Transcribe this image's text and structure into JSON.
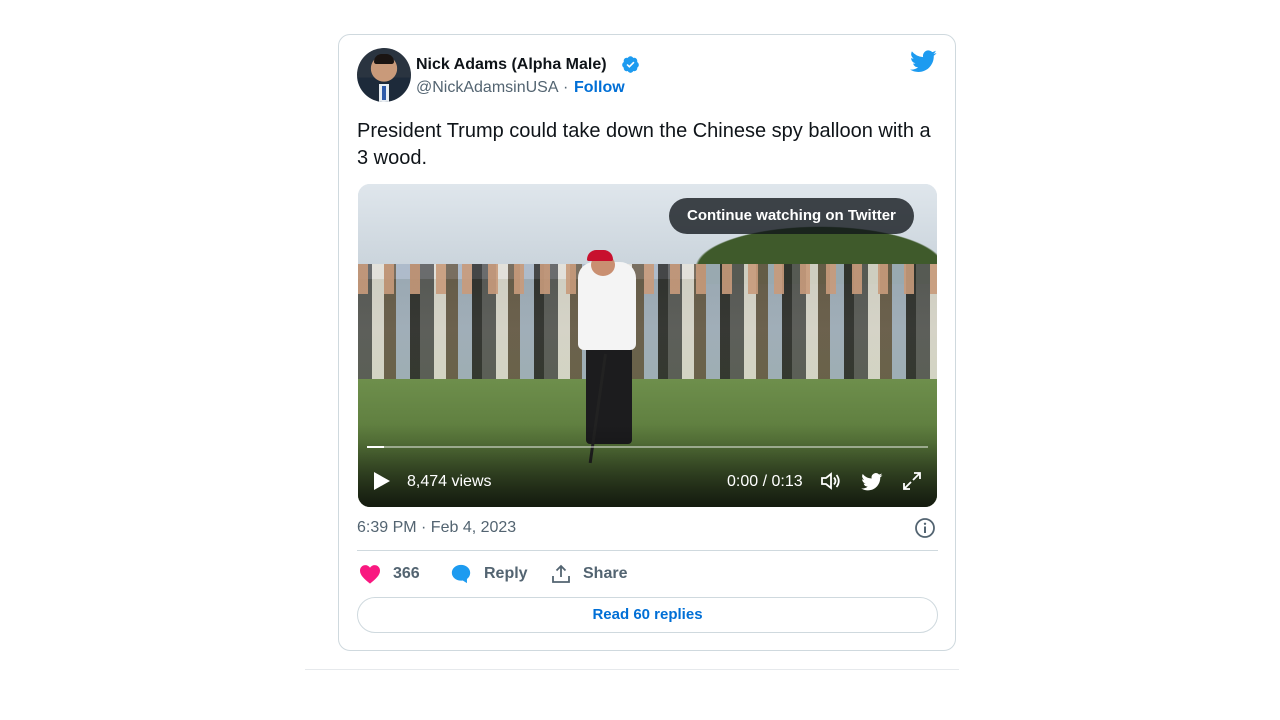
{
  "tweet": {
    "author": {
      "name": "Nick Adams (Alpha Male)",
      "handle": "@NickAdamsinUSA",
      "separator": "·",
      "follow_label": "Follow",
      "verified_icon": "verified-badge-icon",
      "avatar_icon": "profile-avatar"
    },
    "brand_icon": "twitter-bird-icon",
    "text": "President Trump could take down the Chinese spy balloon with a 3 wood.",
    "video": {
      "overlay_label": "Continue watching on Twitter",
      "views": "8,474 views",
      "time": "0:00 / 0:13",
      "progress_fraction": 0.03,
      "icons": [
        "play-icon",
        "volume-icon",
        "twitter-bird-icon",
        "fullscreen-icon"
      ]
    },
    "timestamp": "6:39 PM · Feb 4, 2023",
    "actions": {
      "like_count": "366",
      "reply_label": "Reply",
      "share_label": "Share"
    },
    "read_replies_label": "Read 60 replies",
    "colors": {
      "like": "#f91880",
      "reply": "#1d9bf0",
      "link": "#006fd6",
      "brand": "#1d9bf0",
      "muted": "#536471"
    }
  }
}
